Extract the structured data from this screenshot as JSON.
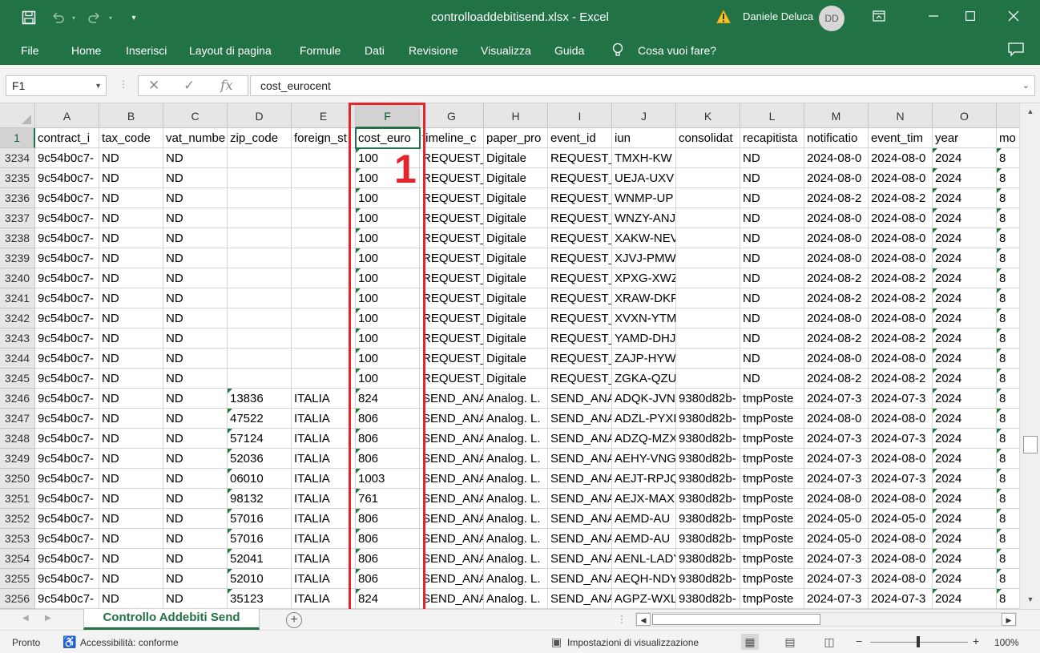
{
  "title_bar": {
    "title": "controlloaddebitisend.xlsx  -  Excel",
    "user_name": "Daniele Deluca",
    "avatar_initials": "DD"
  },
  "ribbon": {
    "tabs": [
      "File",
      "Home",
      "Inserisci",
      "Layout di pagina",
      "Formule",
      "Dati",
      "Revisione",
      "Visualizza",
      "Guida"
    ],
    "tell_me": "Cosa vuoi fare?"
  },
  "formula_bar": {
    "name_box": "F1",
    "formula": "cost_eurocent"
  },
  "columns": [
    "A",
    "B",
    "C",
    "D",
    "E",
    "F",
    "G",
    "H",
    "I",
    "J",
    "K",
    "L",
    "M",
    "N",
    "O",
    ""
  ],
  "header_row": {
    "row_number": "1",
    "cells": [
      "contract_i",
      "tax_code",
      "vat_numbe",
      "zip_code",
      "foreign_st",
      "cost_euro",
      "timeline_c",
      "paper_pro",
      "event_id",
      "iun",
      "consolidat",
      "recapitista",
      "notificatio",
      "event_tim",
      "year",
      "mo"
    ]
  },
  "rows": [
    {
      "n": "3234",
      "c": [
        "9c54b0c7-",
        "ND",
        "ND",
        "",
        "",
        "100",
        "REQUEST_",
        "Digitale",
        "REQUEST_",
        "TMXH-KW",
        "",
        "ND",
        "2024-08-0",
        "2024-08-0",
        "2024",
        "8"
      ]
    },
    {
      "n": "3235",
      "c": [
        "9c54b0c7-",
        "ND",
        "ND",
        "",
        "",
        "100",
        "REQUEST_",
        "Digitale",
        "REQUEST_",
        "UEJA-UXV",
        "",
        "ND",
        "2024-08-0",
        "2024-08-0",
        "2024",
        "8"
      ]
    },
    {
      "n": "3236",
      "c": [
        "9c54b0c7-",
        "ND",
        "ND",
        "",
        "",
        "100",
        "REQUEST_",
        "Digitale",
        "REQUEST_",
        "WNMP-UP",
        "",
        "ND",
        "2024-08-2",
        "2024-08-2",
        "2024",
        "8"
      ]
    },
    {
      "n": "3237",
      "c": [
        "9c54b0c7-",
        "ND",
        "ND",
        "",
        "",
        "100",
        "REQUEST_",
        "Digitale",
        "REQUEST_",
        "WNZY-ANJ",
        "",
        "ND",
        "2024-08-0",
        "2024-08-0",
        "2024",
        "8"
      ]
    },
    {
      "n": "3238",
      "c": [
        "9c54b0c7-",
        "ND",
        "ND",
        "",
        "",
        "100",
        "REQUEST_",
        "Digitale",
        "REQUEST_",
        "XAKW-NEV",
        "",
        "ND",
        "2024-08-0",
        "2024-08-0",
        "2024",
        "8"
      ]
    },
    {
      "n": "3239",
      "c": [
        "9c54b0c7-",
        "ND",
        "ND",
        "",
        "",
        "100",
        "REQUEST_",
        "Digitale",
        "REQUEST_",
        "XJVJ-PMW",
        "",
        "ND",
        "2024-08-0",
        "2024-08-0",
        "2024",
        "8"
      ]
    },
    {
      "n": "3240",
      "c": [
        "9c54b0c7-",
        "ND",
        "ND",
        "",
        "",
        "100",
        "REQUEST_",
        "Digitale",
        "REQUEST_",
        "XPXG-XWZ",
        "",
        "ND",
        "2024-08-2",
        "2024-08-2",
        "2024",
        "8"
      ]
    },
    {
      "n": "3241",
      "c": [
        "9c54b0c7-",
        "ND",
        "ND",
        "",
        "",
        "100",
        "REQUEST_",
        "Digitale",
        "REQUEST_",
        "XRAW-DKF",
        "",
        "ND",
        "2024-08-2",
        "2024-08-2",
        "2024",
        "8"
      ]
    },
    {
      "n": "3242",
      "c": [
        "9c54b0c7-",
        "ND",
        "ND",
        "",
        "",
        "100",
        "REQUEST_",
        "Digitale",
        "REQUEST_",
        "XVXN-YTM",
        "",
        "ND",
        "2024-08-0",
        "2024-08-0",
        "2024",
        "8"
      ]
    },
    {
      "n": "3243",
      "c": [
        "9c54b0c7-",
        "ND",
        "ND",
        "",
        "",
        "100",
        "REQUEST_",
        "Digitale",
        "REQUEST_",
        "YAMD-DHJ",
        "",
        "ND",
        "2024-08-2",
        "2024-08-2",
        "2024",
        "8"
      ]
    },
    {
      "n": "3244",
      "c": [
        "9c54b0c7-",
        "ND",
        "ND",
        "",
        "",
        "100",
        "REQUEST_",
        "Digitale",
        "REQUEST_",
        "ZAJP-HYW",
        "",
        "ND",
        "2024-08-0",
        "2024-08-0",
        "2024",
        "8"
      ]
    },
    {
      "n": "3245",
      "c": [
        "9c54b0c7-",
        "ND",
        "ND",
        "",
        "",
        "100",
        "REQUEST_",
        "Digitale",
        "REQUEST_",
        "ZGKA-QZU",
        "",
        "ND",
        "2024-08-2",
        "2024-08-2",
        "2024",
        "8"
      ]
    },
    {
      "n": "3246",
      "c": [
        "9c54b0c7-",
        "ND",
        "ND",
        "13836",
        "ITALIA",
        "824",
        "SEND_ANA",
        "Analog. L.",
        "SEND_ANA",
        "ADQK-JVN",
        "9380d82b-",
        "tmpPoste",
        "2024-07-3",
        "2024-07-3",
        "2024",
        "8"
      ]
    },
    {
      "n": "3247",
      "c": [
        "9c54b0c7-",
        "ND",
        "ND",
        "47522",
        "ITALIA",
        "806",
        "SEND_ANA",
        "Analog. L.",
        "SEND_ANA",
        "ADZL-PYXL",
        "9380d82b-",
        "tmpPoste",
        "2024-08-0",
        "2024-08-0",
        "2024",
        "8"
      ]
    },
    {
      "n": "3248",
      "c": [
        "9c54b0c7-",
        "ND",
        "ND",
        "57124",
        "ITALIA",
        "806",
        "SEND_ANA",
        "Analog. L.",
        "SEND_ANA",
        "ADZQ-MZX",
        "9380d82b-",
        "tmpPoste",
        "2024-07-3",
        "2024-07-3",
        "2024",
        "8"
      ]
    },
    {
      "n": "3249",
      "c": [
        "9c54b0c7-",
        "ND",
        "ND",
        "52036",
        "ITALIA",
        "806",
        "SEND_ANA",
        "Analog. L.",
        "SEND_ANA",
        "AEHY-VNG",
        "9380d82b-",
        "tmpPoste",
        "2024-07-3",
        "2024-08-0",
        "2024",
        "8"
      ]
    },
    {
      "n": "3250",
      "c": [
        "9c54b0c7-",
        "ND",
        "ND",
        "06010",
        "ITALIA",
        "1003",
        "SEND_ANA",
        "Analog. L.",
        "SEND_ANA",
        "AEJT-RPJQ",
        "9380d82b-",
        "tmpPoste",
        "2024-07-3",
        "2024-07-3",
        "2024",
        "8"
      ]
    },
    {
      "n": "3251",
      "c": [
        "9c54b0c7-",
        "ND",
        "ND",
        "98132",
        "ITALIA",
        "761",
        "SEND_ANA",
        "Analog. L.",
        "SEND_ANA",
        "AEJX-MAX",
        "9380d82b-",
        "tmpPoste",
        "2024-08-0",
        "2024-08-0",
        "2024",
        "8"
      ]
    },
    {
      "n": "3252",
      "c": [
        "9c54b0c7-",
        "ND",
        "ND",
        "57016",
        "ITALIA",
        "806",
        "SEND_ANA",
        "Analog. L.",
        "SEND_ANA",
        "AEMD-AU",
        "9380d82b-",
        "tmpPoste",
        "2024-05-0",
        "2024-05-0",
        "2024",
        "8"
      ]
    },
    {
      "n": "3253",
      "c": [
        "9c54b0c7-",
        "ND",
        "ND",
        "57016",
        "ITALIA",
        "806",
        "SEND_ANA",
        "Analog. L.",
        "SEND_ANA",
        "AEMD-AU",
        "9380d82b-",
        "tmpPoste",
        "2024-05-0",
        "2024-08-0",
        "2024",
        "8"
      ]
    },
    {
      "n": "3254",
      "c": [
        "9c54b0c7-",
        "ND",
        "ND",
        "52041",
        "ITALIA",
        "806",
        "SEND_ANA",
        "Analog. L.",
        "SEND_ANA",
        "AENL-LADY",
        "9380d82b-",
        "tmpPoste",
        "2024-07-3",
        "2024-08-0",
        "2024",
        "8"
      ]
    },
    {
      "n": "3255",
      "c": [
        "9c54b0c7-",
        "ND",
        "ND",
        "52010",
        "ITALIA",
        "806",
        "SEND_ANA",
        "Analog. L.",
        "SEND_ANA",
        "AEQH-NDY",
        "9380d82b-",
        "tmpPoste",
        "2024-07-3",
        "2024-08-0",
        "2024",
        "8"
      ]
    },
    {
      "n": "3256",
      "c": [
        "9c54b0c7-",
        "ND",
        "ND",
        "35123",
        "ITALIA",
        "824",
        "SEND_ANA",
        "Analog. L.",
        "SEND_ANA",
        "AGPZ-WXL",
        "9380d82b-",
        "tmpPoste",
        "2024-07-3",
        "2024-07-3",
        "2024",
        "8"
      ]
    }
  ],
  "annotation": {
    "label": "1",
    "color": "#e3262c"
  },
  "sheet_tabs": {
    "active": "Controllo Addebiti Send"
  },
  "status_bar": {
    "ready": "Pronto",
    "accessibility": "Accessibilità: conforme",
    "display_settings": "Impostazioni di visualizzazione",
    "zoom": "100%"
  },
  "colors": {
    "excel_green": "#217346",
    "annotation_red": "#e3262c"
  },
  "icons": {
    "save": "save-icon",
    "undo": "undo-icon",
    "redo": "redo-icon",
    "customize": "customize-qat-icon",
    "warning": "warning-icon",
    "ribbon_display": "ribbon-display-icon",
    "minimize": "minimize-icon",
    "maximize": "maximize-icon",
    "close": "close-icon",
    "lightbulb": "lightbulb-icon",
    "comments": "comments-icon"
  }
}
